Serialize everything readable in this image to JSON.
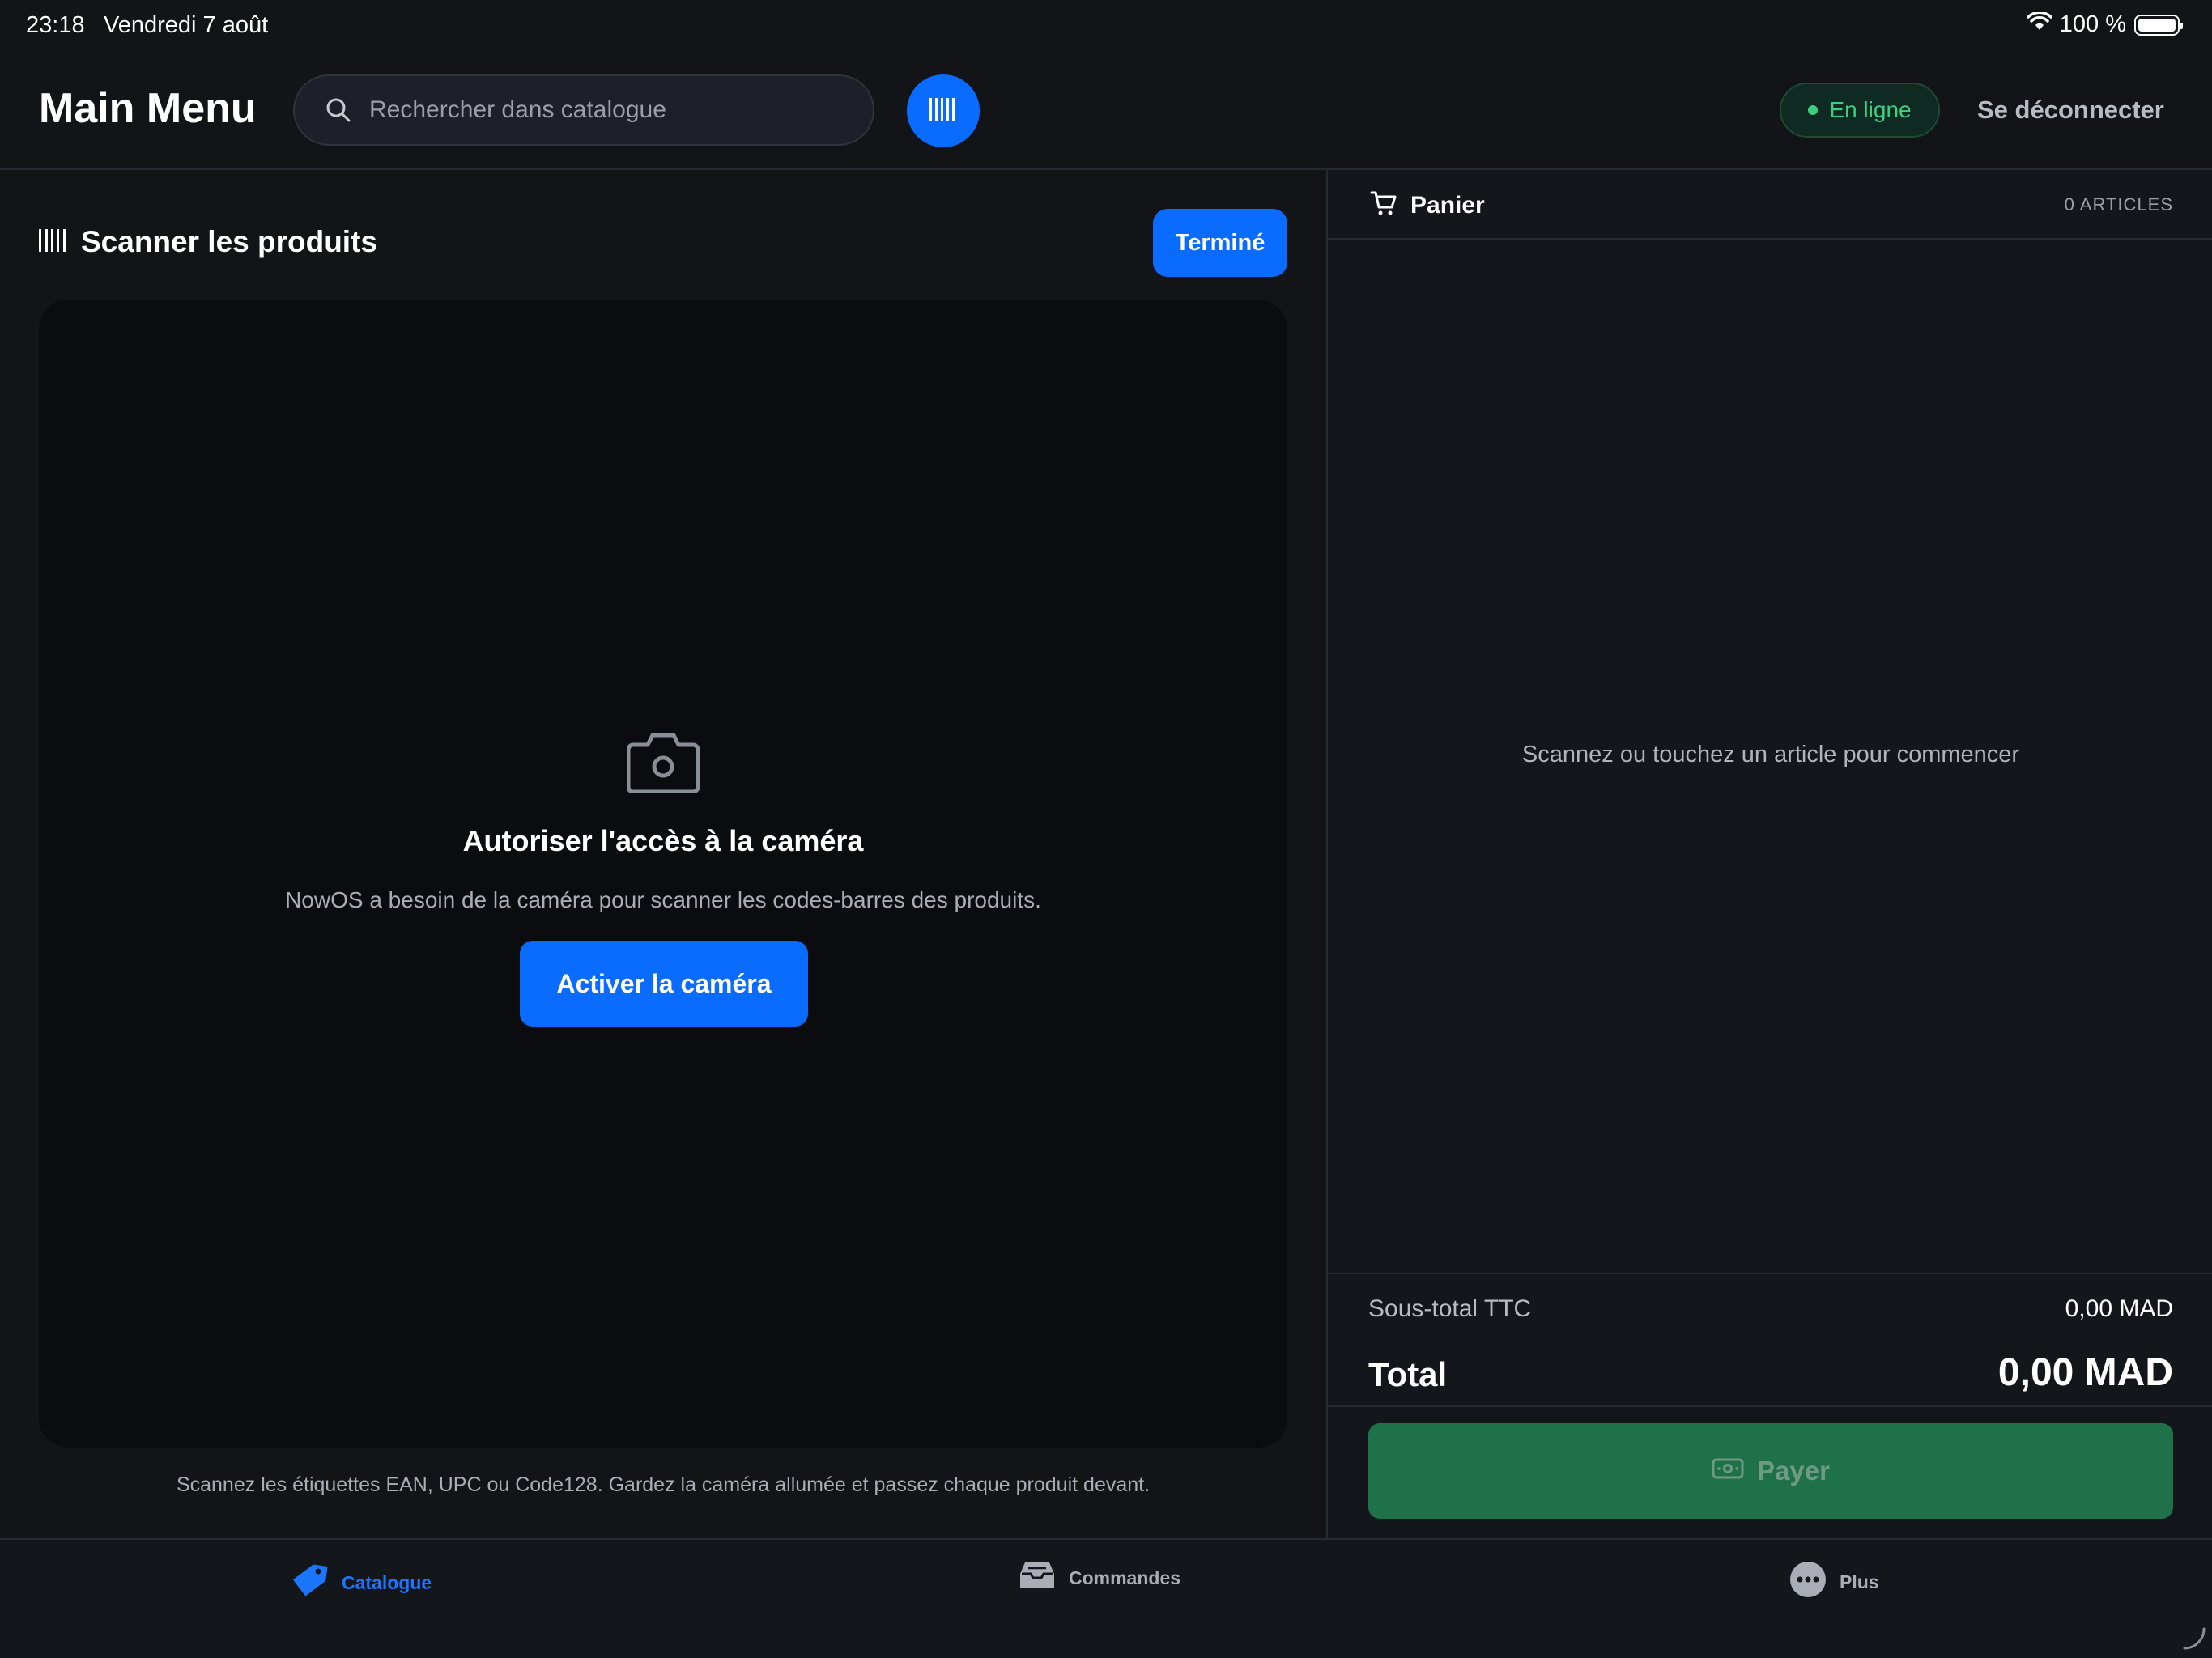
{
  "status_bar": {
    "time": "23:18",
    "date": "Vendredi 7 août",
    "battery": "100 %"
  },
  "header": {
    "title": "Main Menu",
    "search_placeholder": "Rechercher dans catalogue",
    "status_badge": "En ligne",
    "logout_label": "Se déconnecter"
  },
  "scanner": {
    "title": "Scanner les produits",
    "done_label": "Terminé",
    "camera_title": "Autoriser l'accès à la caméra",
    "camera_description": "NowOS a besoin de la caméra pour scanner les codes-barres des produits.",
    "activate_label": "Activer la caméra",
    "hint": "Scannez les étiquettes EAN, UPC ou Code128. Gardez la caméra allumée et passez chaque produit devant."
  },
  "cart": {
    "title": "Panier",
    "count": "0 ARTICLES",
    "empty_message": "Scannez ou touchez un article pour commencer",
    "subtotal_label": "Sous-total TTC",
    "subtotal_value": "0,00 MAD",
    "total_label": "Total",
    "total_value": "0,00 MAD",
    "pay_label": "Payer"
  },
  "tabs": [
    {
      "label": "Catalogue",
      "icon": "tag-icon",
      "active": true
    },
    {
      "label": "Commandes",
      "icon": "inbox-tray-icon",
      "active": false
    },
    {
      "label": "Plus",
      "icon": "more-dots-icon",
      "active": false
    }
  ],
  "colors": {
    "accent": "#0a6cff",
    "background": "#121418",
    "online": "#3ad07f",
    "pay": "#1e7148"
  }
}
